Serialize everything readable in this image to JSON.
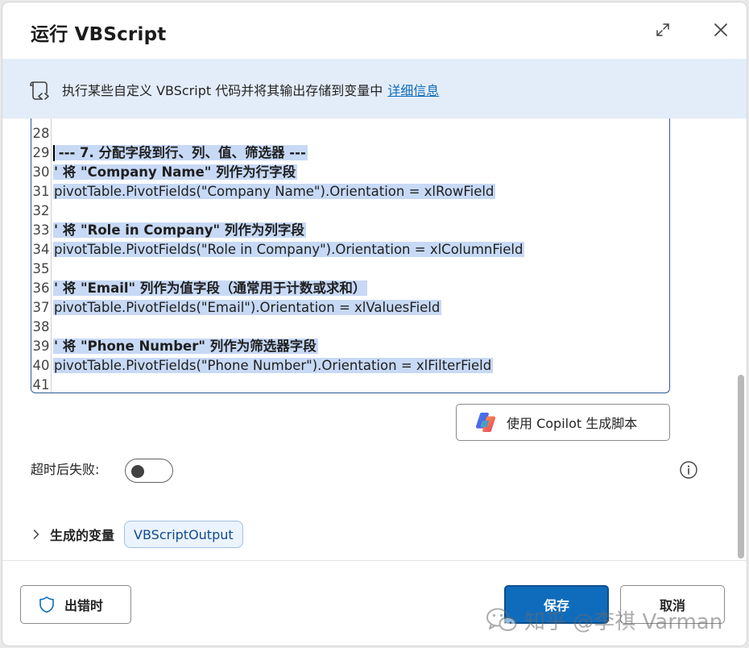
{
  "dialog": {
    "title": "运行 VBScript"
  },
  "banner": {
    "text": "执行某些自定义 VBScript 代码并将其输出存储到变量中",
    "link": "详细信息"
  },
  "editor": {
    "lines": [
      {
        "num": "28",
        "text": "",
        "bold": false,
        "selected": true
      },
      {
        "num": "29",
        "text": " --- 7. 分配字段到行、列、值、筛选器 ---",
        "bold": true,
        "selected": true
      },
      {
        "num": "30",
        "text": "' 将 \"Company Name\" 列作为行字段",
        "bold": true,
        "selected": true
      },
      {
        "num": "31",
        "text": "pivotTable.PivotFields(\"Company Name\").Orientation = xlRowField",
        "bold": false,
        "selected": true
      },
      {
        "num": "32",
        "text": "",
        "bold": false,
        "selected": true
      },
      {
        "num": "33",
        "text": "' 将 \"Role in Company\" 列作为列字段",
        "bold": true,
        "selected": true
      },
      {
        "num": "34",
        "text": "pivotTable.PivotFields(\"Role in Company\").Orientation = xlColumnField",
        "bold": false,
        "selected": true
      },
      {
        "num": "35",
        "text": "",
        "bold": false,
        "selected": true
      },
      {
        "num": "36",
        "text": "' 将 \"Email\" 列作为值字段（通常用于计数或求和）",
        "bold": true,
        "selected": true
      },
      {
        "num": "37",
        "text": "pivotTable.PivotFields(\"Email\").Orientation = xlValuesField",
        "bold": false,
        "selected": true
      },
      {
        "num": "38",
        "text": "",
        "bold": false,
        "selected": true
      },
      {
        "num": "39",
        "text": "' 将 \"Phone Number\" 列作为筛选器字段",
        "bold": true,
        "selected": true
      },
      {
        "num": "40",
        "text": "pivotTable.PivotFields(\"Phone Number\").Orientation = xlFilterField",
        "bold": false,
        "selected": true
      },
      {
        "num": "41",
        "text": "",
        "bold": false,
        "selected": false
      }
    ]
  },
  "copilot": {
    "label": "使用 Copilot 生成脚本"
  },
  "timeout": {
    "label": "超时后失败:",
    "enabled": false
  },
  "variables": {
    "label": "生成的变量",
    "items": [
      "VBScriptOutput"
    ]
  },
  "footer": {
    "on_error_label": "出错时",
    "save_label": "保存",
    "cancel_label": "取消"
  },
  "watermark": {
    "text": "知乎 @李祺 Varman"
  },
  "colors": {
    "accent": "#0f6cbd",
    "banner_bg": "#e3edf9",
    "selection": "#c7d9f5"
  }
}
